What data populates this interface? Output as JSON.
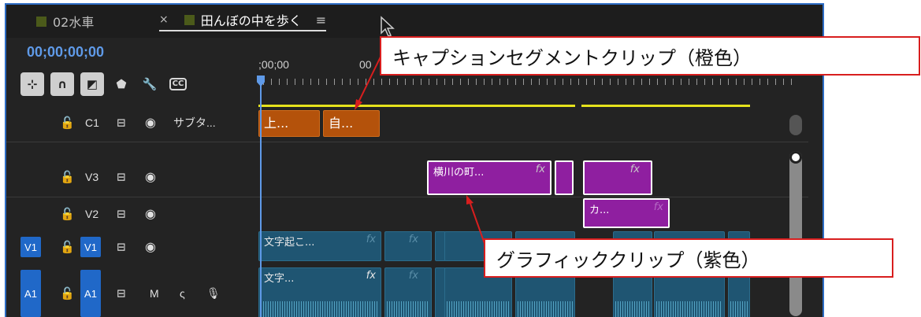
{
  "tabs": [
    {
      "label": "02水車"
    },
    {
      "label": "田んぼの中を歩く",
      "close": "×",
      "menu": "≡"
    }
  ],
  "timecode": "00;00;00;00",
  "ruler": {
    "start": ";00;00",
    "next": "00"
  },
  "tracks": {
    "c1": {
      "name": "C1",
      "label": "サブタ..."
    },
    "v3": {
      "name": "V3"
    },
    "v2": {
      "name": "V2"
    },
    "v1": {
      "source": "V1",
      "name": "V1"
    },
    "a1": {
      "source": "A1",
      "name": "A1",
      "mute": "M",
      "solo": "ς"
    }
  },
  "clips": {
    "caption1": "上...",
    "caption2": "自...",
    "gfx1": "横川の町...",
    "gfx_fx": "fx",
    "gfx3": "カ...",
    "video1": "文字起こ...",
    "audio1": "文字..."
  },
  "callouts": {
    "caption": "キャプションセグメントクリップ（橙色）",
    "graphic": "グラフィッククリップ（紫色）"
  },
  "colors": {
    "caption_clip": "#b4520b",
    "graphic_clip": "#8f1fa0",
    "timecode": "#5f9ae8",
    "callout_border": "#d81e1e"
  }
}
